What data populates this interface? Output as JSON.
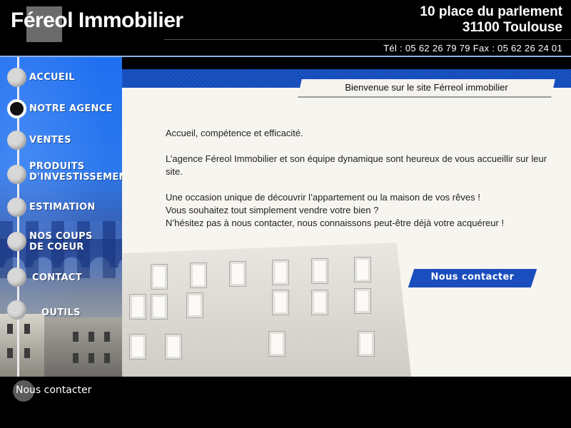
{
  "header": {
    "logo": "Féreol Immobilier",
    "address_line1": "10 place du parlement",
    "address_line2": "31100 Toulouse",
    "phones": "Tél : 05 62 26 79 79   Fax : 05 62 26 24 01"
  },
  "nav": {
    "items": [
      {
        "label": "ACCUEIL",
        "active": false
      },
      {
        "label": "NOTRE AGENCE",
        "active": true
      },
      {
        "label": "VENTES",
        "active": false
      },
      {
        "label": "PRODUITS D'INVESTISSEMENT",
        "line1": "PRODUITS",
        "line2": "D'INVESTISSEMENT",
        "active": false
      },
      {
        "label": "ESTIMATION",
        "active": false
      },
      {
        "label": "NOS COUPS DE COEUR",
        "line1": "NOS COUPS",
        "line2": "DE COEUR",
        "active": false
      },
      {
        "label": "CONTACT",
        "active": false
      },
      {
        "label": "OUTILS",
        "active": false
      }
    ]
  },
  "main": {
    "welcome": "Bienvenue  sur le site Férreol immobilier",
    "paragraphs": {
      "p1": "Accueil, compétence et efficacité.",
      "p2": "L’agence Féreol Immobilier et son équipe dynamique sont heureux de vous accueillir sur leur site.",
      "p3_l1": "Une occasion unique de découvrir l’appartement ou la maison de vos rêves !",
      "p3_l2": "Vous souhaitez tout simplement vendre votre bien ?",
      "p3_l3": "N’hésitez pas à nous contacter, nous connaissons peut-être déjà votre acquéreur !"
    },
    "contact_button": "Nous contacter"
  },
  "footer": {
    "link": "Nous contacter"
  },
  "colors": {
    "accent_blue": "#1a4dbd",
    "header_bg": "#000000",
    "content_bg": "#f7f5ef"
  }
}
